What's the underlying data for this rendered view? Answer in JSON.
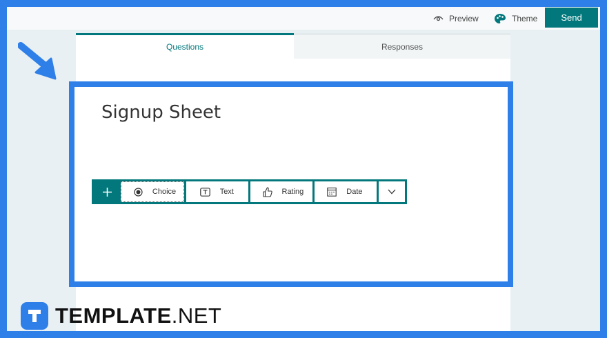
{
  "topbar": {
    "preview_label": "Preview",
    "theme_label": "Theme",
    "send_label": "Send"
  },
  "tabs": [
    {
      "label": "Questions",
      "active": true
    },
    {
      "label": "Responses",
      "active": false
    }
  ],
  "form": {
    "title": "Signup Sheet"
  },
  "toolbar": {
    "add_icon": "plus-icon",
    "buttons": [
      {
        "label": "Choice",
        "icon": "radio-icon"
      },
      {
        "label": "Text",
        "icon": "text-box-icon"
      },
      {
        "label": "Rating",
        "icon": "thumbs-up-icon"
      },
      {
        "label": "Date",
        "icon": "calendar-icon"
      }
    ],
    "more_icon": "chevron-down-icon"
  },
  "watermark": {
    "brand_bold": "TEMPLATE",
    "brand_suffix": ".NET"
  },
  "colors": {
    "accent": "#03787c",
    "highlight": "#2f7fe9",
    "page_bg": "#e8f0f4"
  }
}
